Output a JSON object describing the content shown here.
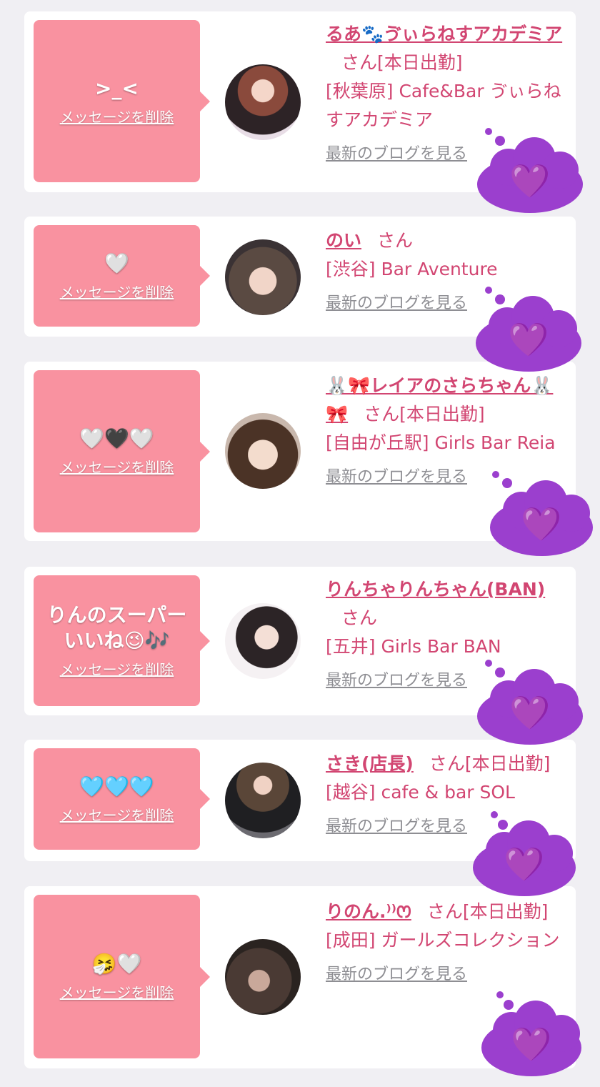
{
  "messages": [
    {
      "message_text": ">_<",
      "delete_label": "メッセージを削除",
      "cast_name": "るあ🐾ゔぃらねすアカデミア",
      "honorific": "さん",
      "status": "[本日出勤]",
      "shop": "[秋葉原] Cafe&Bar ゔぃらねすアカデミア",
      "blog_label": "最新のブログを見る",
      "overlay_emoji": "💜"
    },
    {
      "message_text": "🤍",
      "delete_label": "メッセージを削除",
      "cast_name": "のい",
      "honorific": "さん",
      "status": "",
      "shop": "[渋谷] Bar Aventure",
      "blog_label": "最新のブログを見る",
      "overlay_emoji": "💜"
    },
    {
      "message_text": "🤍🖤🤍",
      "delete_label": "メッセージを削除",
      "cast_name": "🐰🎀レイアのさらちゃん🐰🎀",
      "honorific": "さん",
      "status": "[本日出勤]",
      "shop": "[自由が丘駅] Girls Bar Reia",
      "blog_label": "最新のブログを見る",
      "overlay_emoji": "💜"
    },
    {
      "message_text": "りんのスーパーいいね😉🎶",
      "delete_label": "メッセージを削除",
      "cast_name": "りんちゃりんちゃん(BAN)",
      "honorific": "さん",
      "status": "",
      "shop": "[五井] Girls Bar BAN",
      "blog_label": "最新のブログを見る",
      "overlay_emoji": "💜"
    },
    {
      "message_text": "🩵🩵🩵",
      "delete_label": "メッセージを削除",
      "cast_name": "さき(店長)",
      "honorific": "さん",
      "status": "[本日出勤]",
      "shop": "[越谷] cafe & bar SOL",
      "blog_label": "最新のブログを見る",
      "overlay_emoji": "💜"
    },
    {
      "message_text": "🤧🤍",
      "delete_label": "メッセージを削除",
      "cast_name": "りのん.⁾⁾ꯁ",
      "honorific": "さん",
      "status": "[本日出勤]",
      "shop": "[成田] ガールズコレクション",
      "blog_label": "最新のブログを見る",
      "overlay_emoji": "💜"
    }
  ],
  "colors": {
    "bubble": "#f992a0",
    "link": "#d24672",
    "muted": "#8e8e93",
    "cloud": "#9b3fce",
    "background": "#f0eff3"
  }
}
